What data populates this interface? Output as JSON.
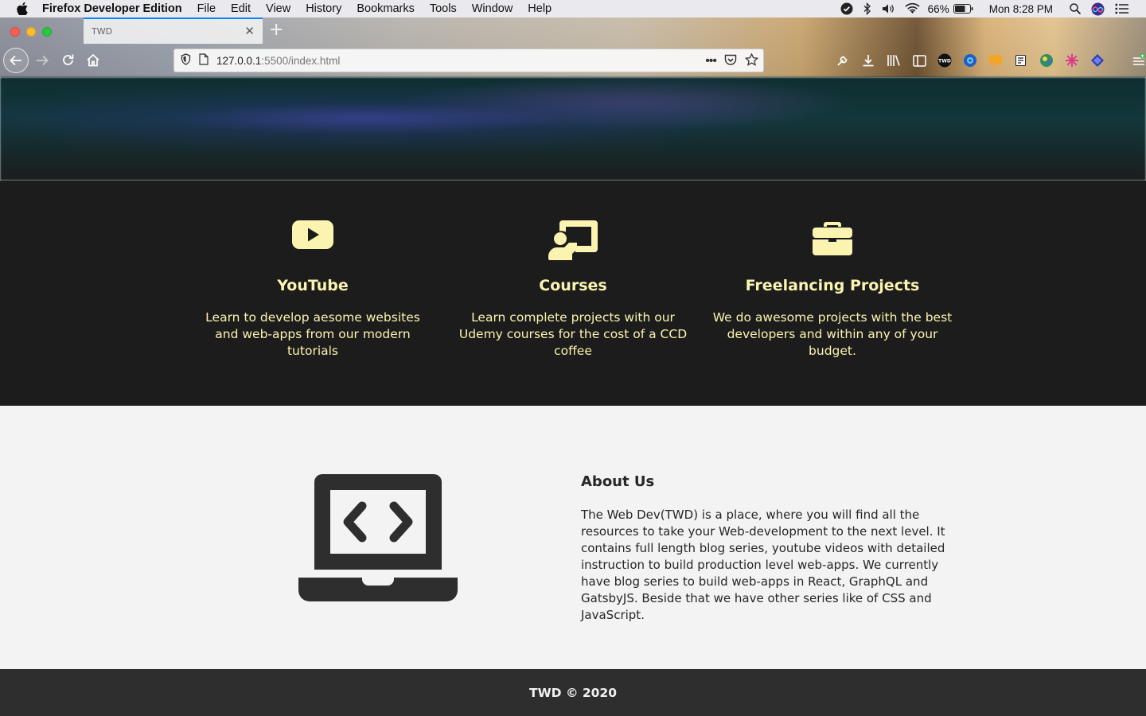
{
  "menubar": {
    "app_name": "Firefox Developer Edition",
    "items": [
      "File",
      "Edit",
      "View",
      "History",
      "Bookmarks",
      "Tools",
      "Window",
      "Help"
    ],
    "battery": "66%",
    "clock": "Mon 8:28 PM"
  },
  "browser": {
    "tab_title": "TWD",
    "url_host": "127.0.0.1",
    "url_rest": ":5500/index.html"
  },
  "services": [
    {
      "title": "YouTube",
      "description": "Learn to develop aesome websites and web-apps from our modern tutorials",
      "icon": "youtube-icon"
    },
    {
      "title": "Courses",
      "description": "Learn complete projects with our Udemy courses for the cost of a CCD coffee",
      "icon": "chalkboard-teacher-icon"
    },
    {
      "title": "Freelancing Projects",
      "description": "We do awesome projects with the best developers and within any of your budget.",
      "icon": "briefcase-icon"
    }
  ],
  "about": {
    "title": "About Us",
    "text": "The Web Dev(TWD) is a place, where you will find all the resources to take your Web-development to the next level. It contains full length blog series, youtube videos with detailed instruction to build production level web-apps. We currently have blog series to build web-apps in React, GraphQL and GatsbyJS. Beside that we have other series like of CSS and JavaScript.",
    "icon": "laptop-code-icon"
  },
  "footer": {
    "text": "TWD © 2020"
  },
  "colors": {
    "accent_text": "#fbf4b0",
    "dark_section": "#1c1c1c",
    "footer_bg": "#2e2e2e",
    "light_section": "#f3f3f3"
  }
}
